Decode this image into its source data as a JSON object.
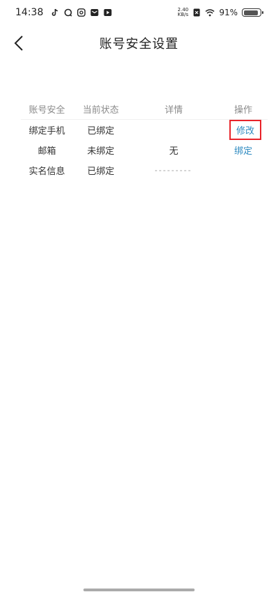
{
  "status_bar": {
    "time": "14:38",
    "net_speed_top": "2.40",
    "net_speed_bottom": "KB/s",
    "battery_text": "91%",
    "battery_level": 0.91,
    "icons": [
      "tiktok-icon",
      "chat-bubble-icon",
      "at-sign-icon",
      "mail-icon",
      "play-icon",
      "sim-x-icon",
      "wifi-icon",
      "battery-icon"
    ]
  },
  "nav": {
    "title": "账号安全设置",
    "back_icon": "chevron-left-icon"
  },
  "table": {
    "headers": [
      "账号安全",
      "当前状态",
      "详情",
      "操作"
    ],
    "rows": [
      {
        "item": "绑定手机",
        "status": "已绑定",
        "detail": "",
        "action": "修改"
      },
      {
        "item": "邮箱",
        "status": "未绑定",
        "detail": "无",
        "action": "绑定"
      },
      {
        "item": "实名信息",
        "status": "已绑定",
        "detail": "",
        "action": ""
      }
    ]
  },
  "colors": {
    "link": "#2e8ac0",
    "highlight_border": "#e8232a",
    "header_text": "#8a8a8a"
  }
}
